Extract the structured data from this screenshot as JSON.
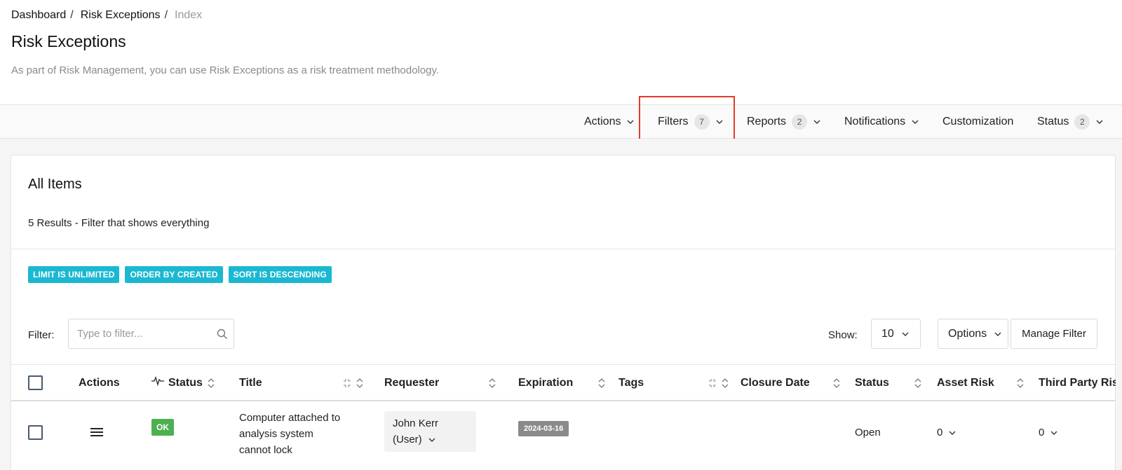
{
  "breadcrumb": {
    "items": [
      "Dashboard",
      "Risk Exceptions"
    ],
    "current": "Index",
    "separator": "/"
  },
  "page": {
    "title": "Risk Exceptions",
    "description": "As part of Risk Management, you can use Risk Exceptions as a risk treatment methodology."
  },
  "toolbar": {
    "actions": {
      "label": "Actions"
    },
    "filters": {
      "label": "Filters",
      "count": "7"
    },
    "reports": {
      "label": "Reports",
      "count": "2"
    },
    "notifications": {
      "label": "Notifications"
    },
    "customization": {
      "label": "Customization"
    },
    "status": {
      "label": "Status",
      "count": "2"
    }
  },
  "panel": {
    "title": "All Items",
    "subtitle": "5 Results - Filter that shows everything",
    "tags": [
      "LIMIT IS UNLIMITED",
      "ORDER BY CREATED",
      "SORT IS DESCENDING"
    ]
  },
  "filter": {
    "label": "Filter:",
    "placeholder": "Type to filter...",
    "value": ""
  },
  "show": {
    "label": "Show:",
    "value": "10"
  },
  "buttons": {
    "options": "Options",
    "manage_filter": "Manage Filter"
  },
  "table": {
    "columns": [
      "Actions",
      "Status",
      "Title",
      "Requester",
      "Expiration",
      "Tags",
      "Closure Date",
      "Status",
      "Asset Risk",
      "Third Party Risk"
    ],
    "rows": [
      {
        "status": "OK",
        "title_lines": [
          "Computer attached to",
          "analysis system",
          "cannot lock"
        ],
        "requester_lines": [
          "John Kerr",
          "(User)"
        ],
        "expiration": "2024-03-16",
        "tags": "",
        "closure_date": "",
        "status2": "Open",
        "asset_risk": "0",
        "third_party_risk": "0"
      }
    ]
  },
  "colors": {
    "accent_tag": "#1bb8d2",
    "ok": "#4caf50",
    "date_badge": "#8a8a8a",
    "highlight": "#e53a2c"
  }
}
